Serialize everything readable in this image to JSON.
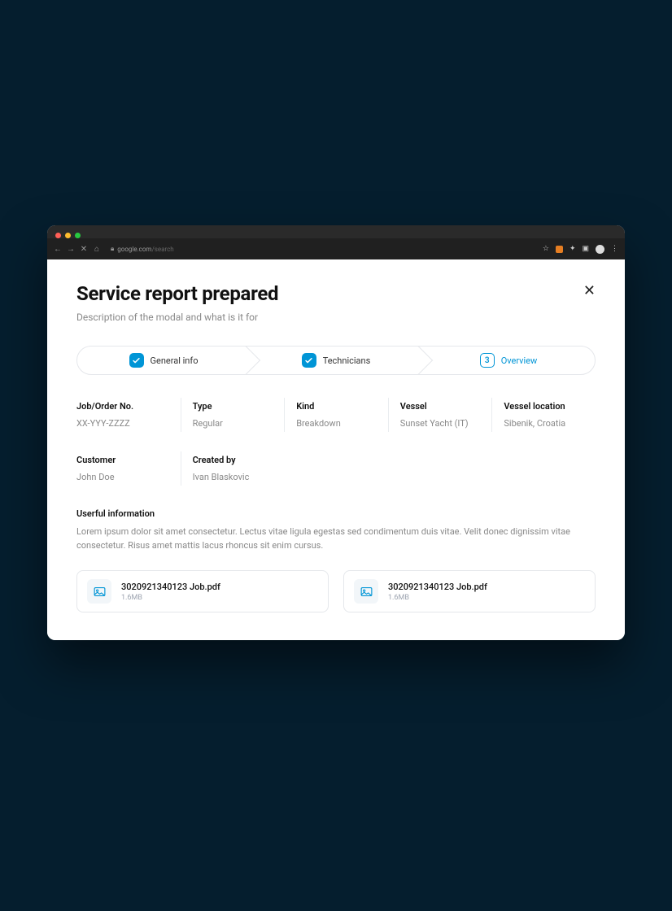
{
  "browser": {
    "url_host": "google.com",
    "url_path": "/search"
  },
  "modal": {
    "title": "Service report prepared",
    "subtitle": "Description of the modal and what is it for"
  },
  "stepper": {
    "steps": [
      {
        "label": "General info"
      },
      {
        "label": "Technicians"
      },
      {
        "label": "Overview",
        "number": "3"
      }
    ]
  },
  "details": [
    {
      "label": "Job/Order No.",
      "value": "XX-YYY-ZZZZ"
    },
    {
      "label": "Type",
      "value": "Regular"
    },
    {
      "label": "Kind",
      "value": "Breakdown"
    },
    {
      "label": "Vessel",
      "value": "Sunset Yacht (IT)"
    },
    {
      "label": "Vessel location",
      "value": "Sibenik, Croatia"
    },
    {
      "label": "Customer",
      "value": "John Doe"
    },
    {
      "label": "Created by",
      "value": "Ivan Blaskovic"
    }
  ],
  "info": {
    "title": "Userful information",
    "text": "Lorem ipsum dolor sit amet consectetur. Lectus vitae ligula egestas sed condimentum duis vitae. Velit donec dignissim vitae consectetur. Risus amet mattis lacus rhoncus sit enim cursus."
  },
  "files": [
    {
      "name": "3020921340123 Job.pdf",
      "size": "1.6MB"
    },
    {
      "name": "3020921340123 Job.pdf",
      "size": "1.6MB"
    }
  ]
}
